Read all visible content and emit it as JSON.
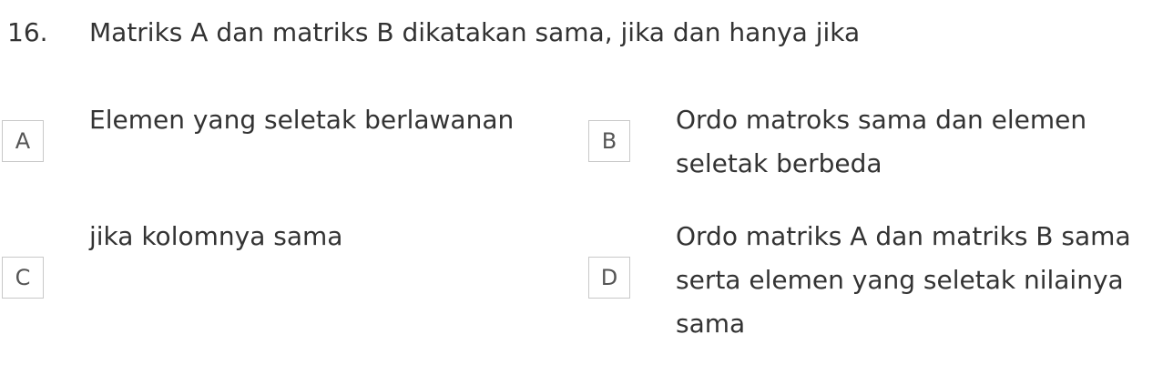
{
  "question": {
    "number": "16.",
    "text": "Matriks A dan matriks B dikatakan sama, jika dan hanya jika"
  },
  "options": [
    {
      "letter": "A",
      "lines": [
        "Elemen yang seletak berlawanan"
      ]
    },
    {
      "letter": "B",
      "lines": [
        "Ordo matroks sama dan elemen",
        "seletak berbeda"
      ]
    },
    {
      "letter": "C",
      "lines": [
        "jika kolomnya sama"
      ]
    },
    {
      "letter": "D",
      "lines": [
        "Ordo matriks A dan matriks B sama",
        "serta elemen yang seletak nilainya",
        "sama"
      ]
    }
  ]
}
